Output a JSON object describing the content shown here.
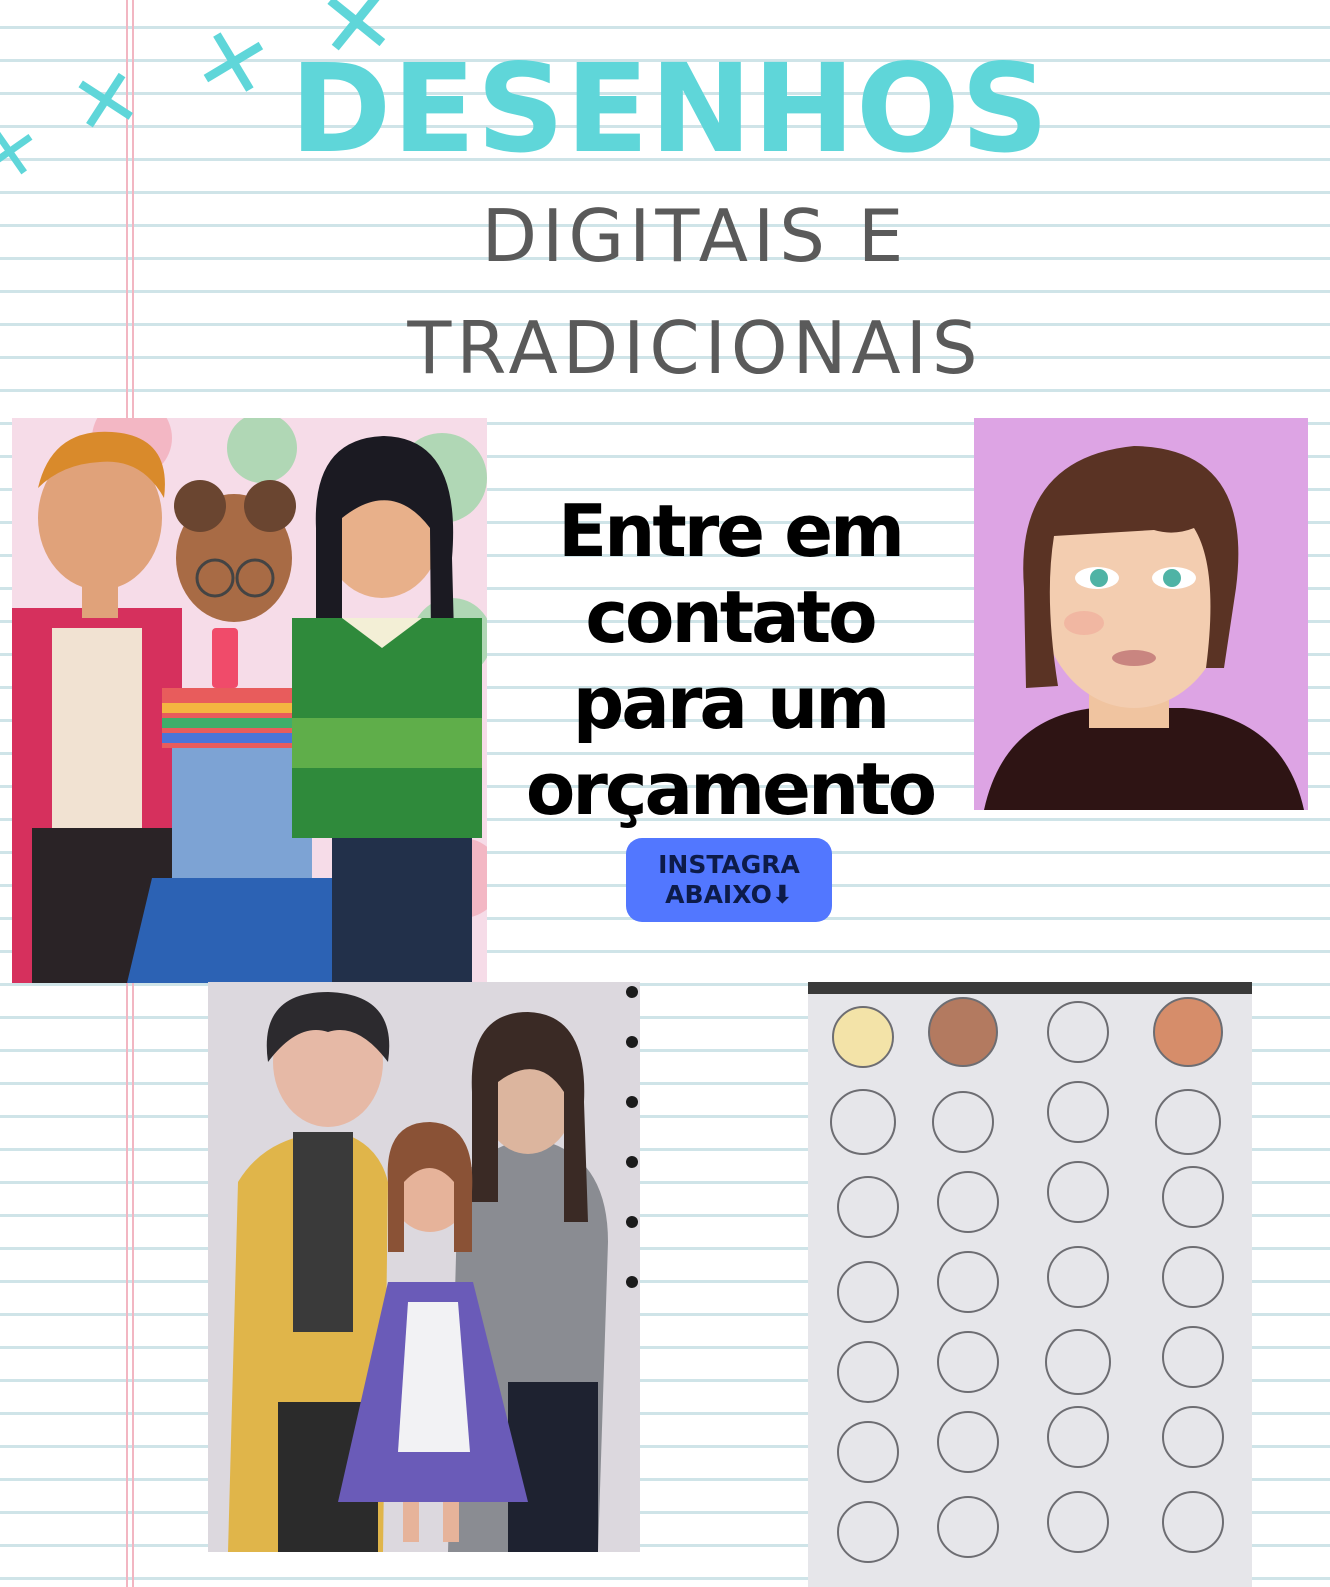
{
  "title": "DESENHOS",
  "subtitle": {
    "line1": "DIGITAIS E",
    "line2": "TRADICIONAIS"
  },
  "cta": {
    "text": "Entre em contato para um orçamento",
    "button_line1": "INSTAGRA",
    "button_line2": "ABAIXO⬇"
  },
  "decor": {
    "cross_glyph": "✕"
  },
  "colors": {
    "accent": "#5fd6d9",
    "subtitle": "#5a5a5a",
    "button": "#5277ff",
    "button_text": "#0d1b49",
    "ruled_line": "#cfe4e8",
    "margin_line": "#f2b6c2"
  }
}
